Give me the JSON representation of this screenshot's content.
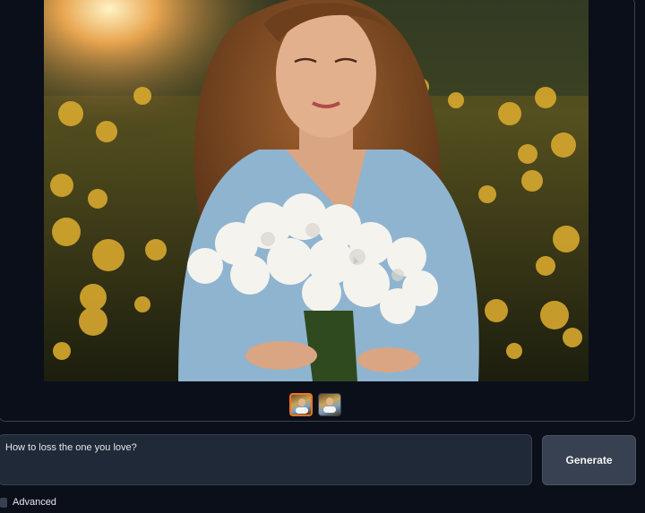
{
  "gallery": {
    "main_image": {
      "description_icon": "portrait-image"
    },
    "thumbnails": [
      {
        "selected": true
      },
      {
        "selected": false
      }
    ]
  },
  "prompt": {
    "value": "How to loss the one you love?"
  },
  "generate_label": "Generate",
  "advanced_label": "Advanced",
  "colors": {
    "background": "#0b0f19",
    "panel_border": "#374151",
    "input_bg": "#1f2937",
    "button_bg": "#374151",
    "accent": "#f97316"
  }
}
